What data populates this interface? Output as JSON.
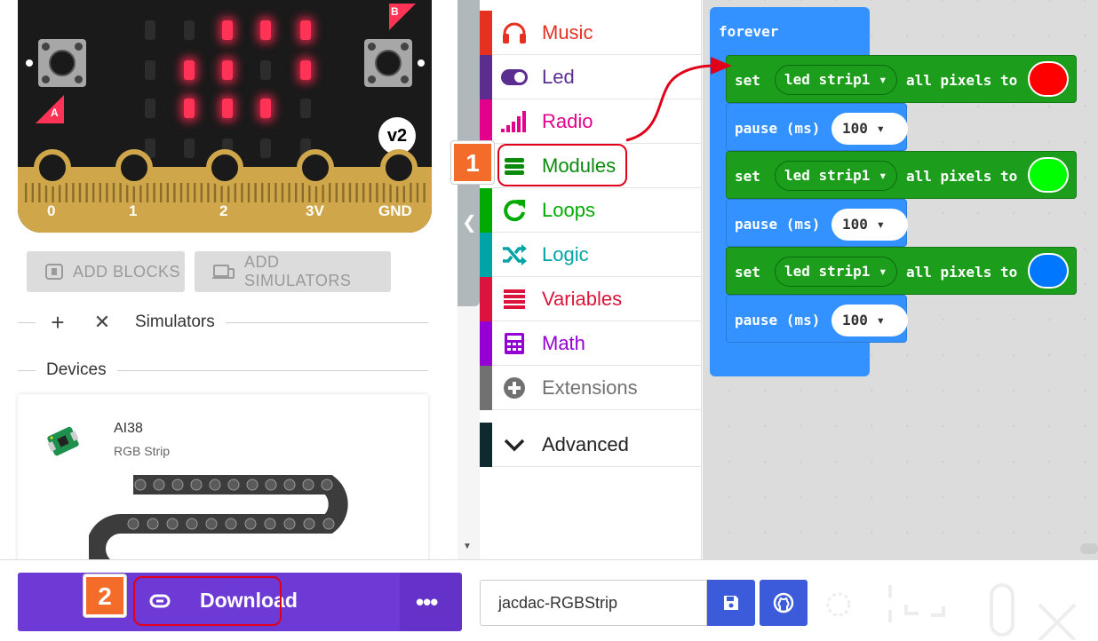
{
  "board": {
    "pins": [
      "0",
      "1",
      "2",
      "3V",
      "GND"
    ],
    "button_a": "A",
    "button_b": "B",
    "version": "v2",
    "led_matrix": [
      [
        0,
        0,
        1,
        1,
        1
      ],
      [
        0,
        1,
        1,
        0,
        1
      ],
      [
        0,
        1,
        1,
        1,
        0
      ],
      [
        0,
        0,
        0,
        0,
        0
      ],
      [
        0,
        0,
        0,
        0,
        0
      ]
    ]
  },
  "sim_actions": {
    "add_blocks": "ADD BLOCKS",
    "add_simulators": "ADD SIMULATORS"
  },
  "simulators_section": {
    "add_glyph": "+",
    "close_glyph": "✕",
    "label": "Simulators"
  },
  "devices_section": {
    "label": "Devices",
    "device": {
      "name": "AI38",
      "type": "RGB Strip"
    }
  },
  "toolbox": {
    "categories": [
      {
        "label": "Music",
        "color": "#e63022",
        "icon": "headphones-icon"
      },
      {
        "label": "Led",
        "color": "#5c2d91",
        "icon": "toggle-icon"
      },
      {
        "label": "Radio",
        "color": "#e3008c",
        "icon": "signal-bars-icon"
      },
      {
        "label": "Modules",
        "color": "#0b8a0b",
        "icon": "modules-list-icon"
      },
      {
        "label": "Loops",
        "color": "#00aa00",
        "icon": "refresh-icon"
      },
      {
        "label": "Logic",
        "color": "#00a4a6",
        "icon": "shuffle-icon"
      },
      {
        "label": "Variables",
        "color": "#dc143c",
        "icon": "list-icon"
      },
      {
        "label": "Math",
        "color": "#9400d3",
        "icon": "calculator-icon"
      },
      {
        "label": "Extensions",
        "color": "#717171",
        "icon": "plus-circle-icon"
      },
      {
        "label": "Advanced",
        "color": "#222222",
        "icon": "chevron-down-icon"
      }
    ]
  },
  "workspace": {
    "forever_label": "forever",
    "steps": [
      {
        "set_word": "set",
        "strip": "led strip1",
        "action": "all pixels to",
        "color": "#ff0000",
        "pause_word": "pause (ms)",
        "pause_value": "100"
      },
      {
        "set_word": "set",
        "strip": "led strip1",
        "action": "all pixels to",
        "color": "#00ff00",
        "pause_word": "pause (ms)",
        "pause_value": "100"
      },
      {
        "set_word": "set",
        "strip": "led strip1",
        "action": "all pixels to",
        "color": "#0077ff",
        "pause_word": "pause (ms)",
        "pause_value": "100"
      }
    ]
  },
  "bottom": {
    "download": "Download",
    "more": "•••",
    "project_name": "jacdac-RGBStrip"
  },
  "callouts": {
    "first": "1",
    "second": "2"
  }
}
